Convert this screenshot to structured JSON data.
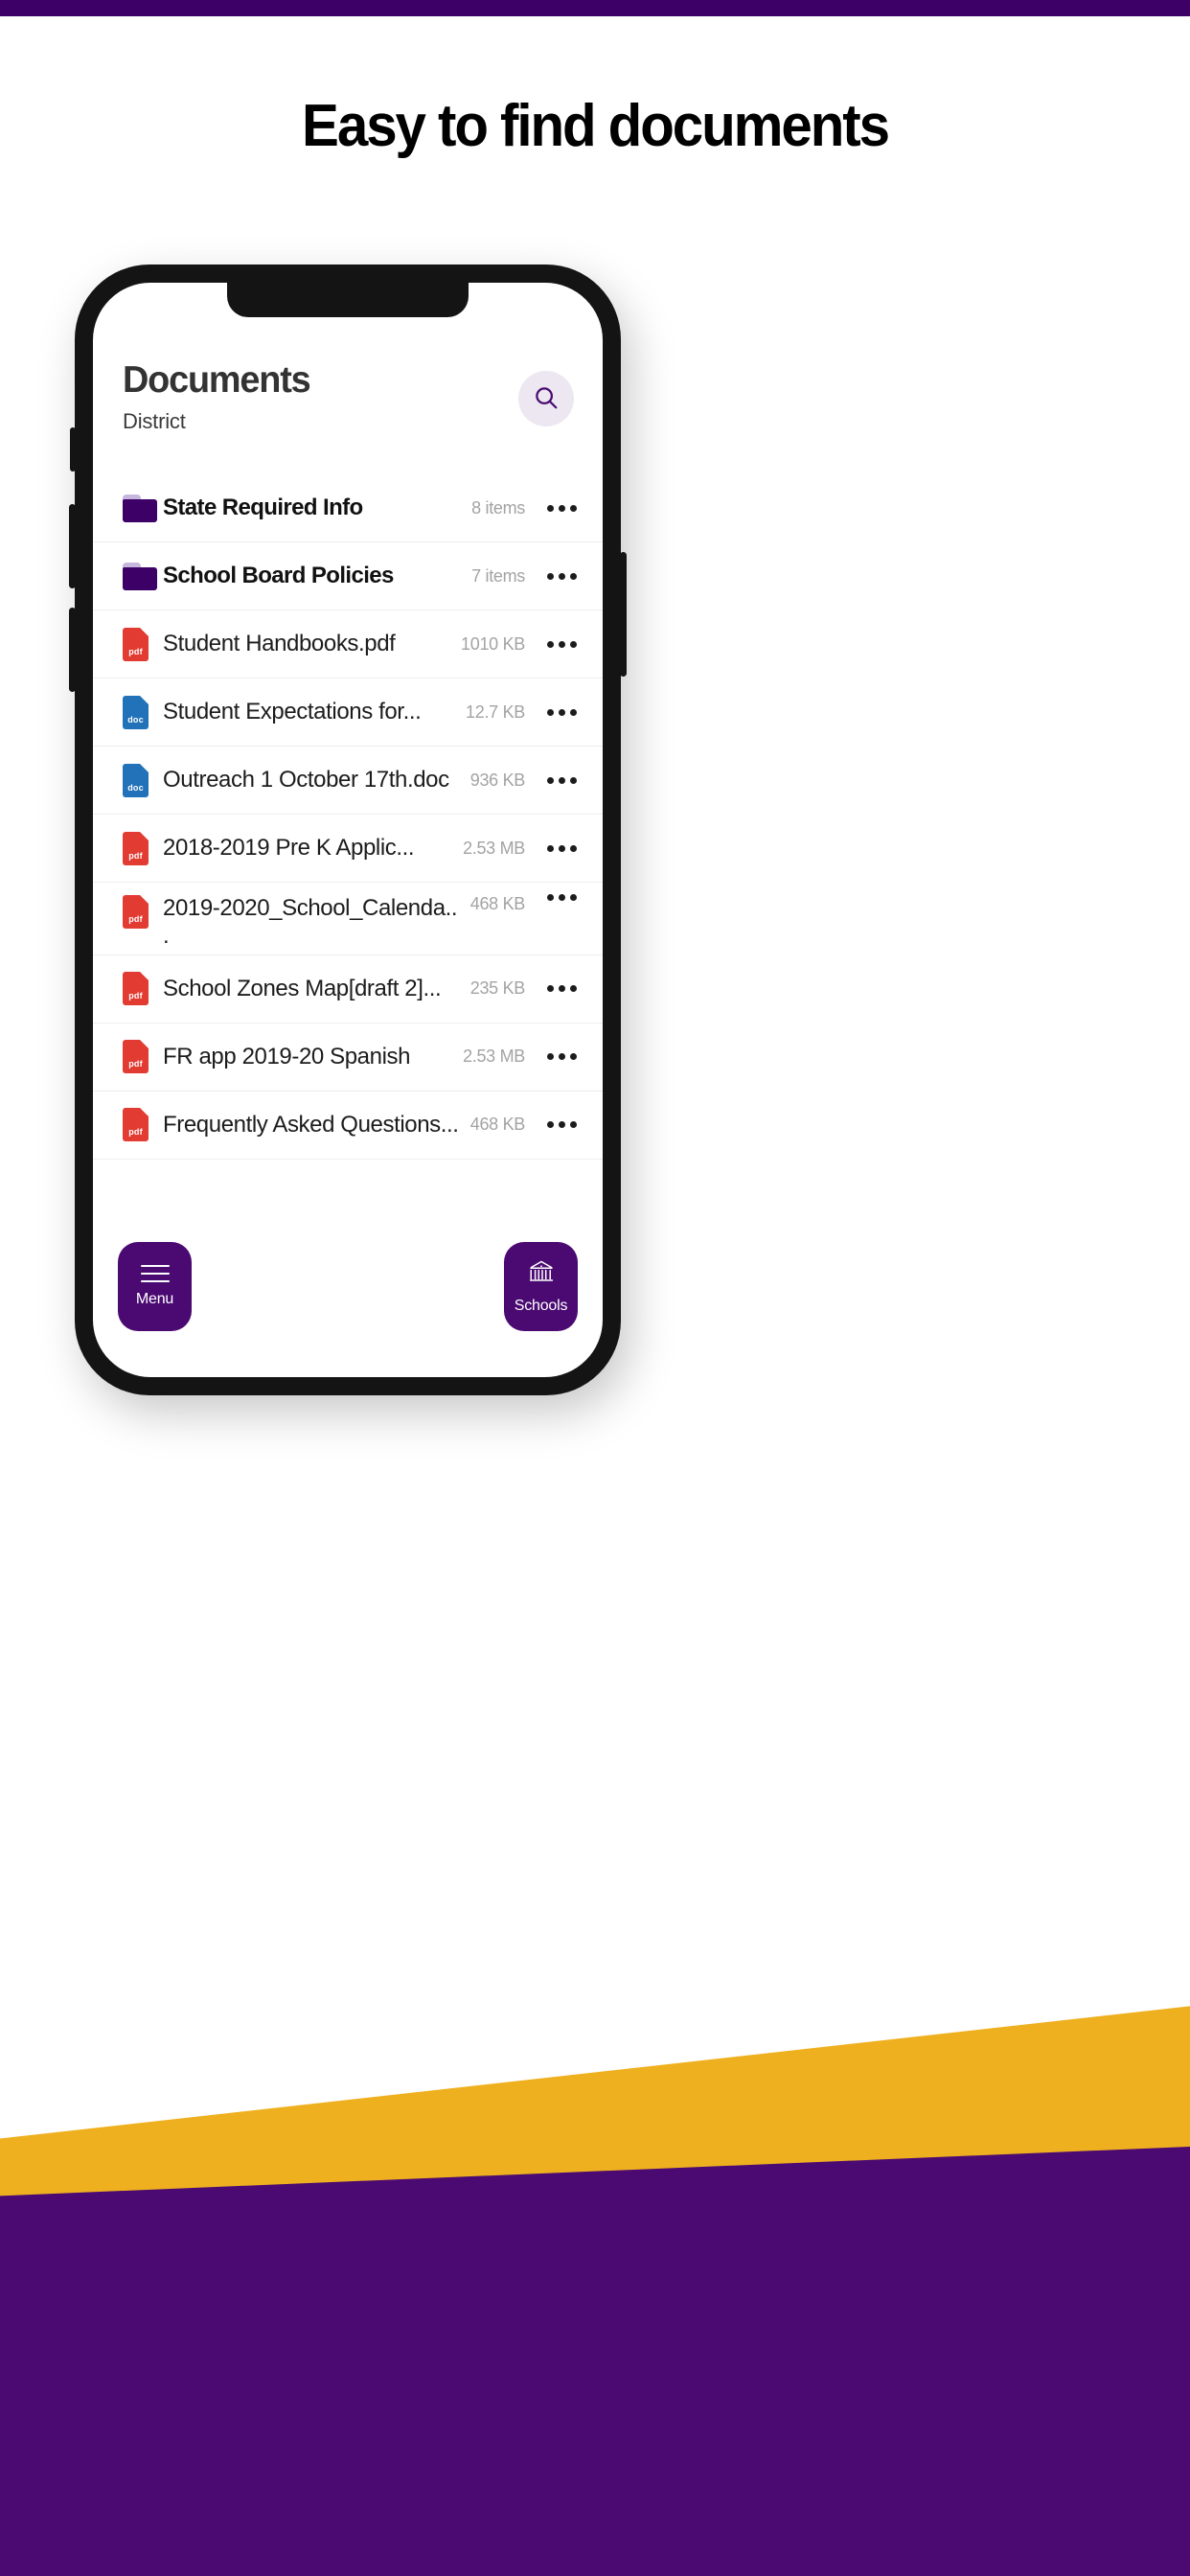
{
  "promo": {
    "headline": "Easy to find documents",
    "accent_purple": "#3d0066",
    "accent_yellow": "#efb01f",
    "bg_purple": "#4a0a72"
  },
  "app": {
    "header": {
      "title": "Documents",
      "subtitle": "District",
      "search_icon": "search-icon"
    },
    "rows": [
      {
        "type": "folder",
        "name": "State Required Info",
        "meta": "8 items",
        "icon": "folder-icon"
      },
      {
        "type": "folder",
        "name": "School Board Policies",
        "meta": "7 items",
        "icon": "folder-icon"
      },
      {
        "type": "pdf",
        "name": "Student Handbooks.pdf",
        "meta": "1010 KB",
        "icon": "pdf-file-icon",
        "ext": "pdf"
      },
      {
        "type": "doc",
        "name": "Student Expectations for...",
        "meta": "12.7 KB",
        "icon": "doc-file-icon",
        "ext": "doc"
      },
      {
        "type": "doc",
        "name": "Outreach 1 October 17th.doc",
        "meta": "936 KB",
        "icon": "doc-file-icon",
        "ext": "doc"
      },
      {
        "type": "pdf",
        "name": "2018-2019 Pre K Applic...",
        "meta": "2.53 MB",
        "icon": "pdf-file-icon",
        "ext": "pdf"
      },
      {
        "type": "pdf",
        "name": "2019-2020_School_Calenda..",
        "meta": "468 KB",
        "icon": "pdf-file-icon",
        "ext": "pdf",
        "wrap": true,
        "second_line": "."
      },
      {
        "type": "pdf",
        "name": "School Zones Map[draft 2]...",
        "meta": "235 KB",
        "icon": "pdf-file-icon",
        "ext": "pdf"
      },
      {
        "type": "pdf",
        "name": "FR app 2019-20 Spanish",
        "meta": "2.53 MB",
        "icon": "pdf-file-icon",
        "ext": "pdf"
      },
      {
        "type": "pdf",
        "name": "Frequently Asked Questions...",
        "meta": "468 KB",
        "icon": "pdf-file-icon",
        "ext": "pdf"
      }
    ],
    "overflow_icon": "more-options-icon",
    "bottom_nav": [
      {
        "label": "Menu",
        "icon": "hamburger-menu-icon"
      },
      {
        "label": "Schools",
        "icon": "school-building-icon"
      }
    ]
  }
}
